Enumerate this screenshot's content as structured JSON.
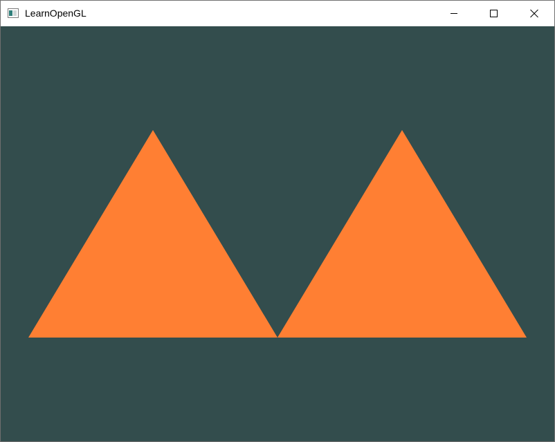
{
  "window": {
    "title": "LearnOpenGL",
    "app_icon": "opengl-window-icon",
    "controls": {
      "minimize_icon": "minimize-icon",
      "maximize_icon": "maximize-icon",
      "close_icon": "close-icon"
    }
  },
  "viewport": {
    "clear_color": "#334d4d",
    "triangles": [
      {
        "name": "left-triangle",
        "color": "#ff7f33"
      },
      {
        "name": "right-triangle",
        "color": "#ff7f33"
      }
    ]
  }
}
